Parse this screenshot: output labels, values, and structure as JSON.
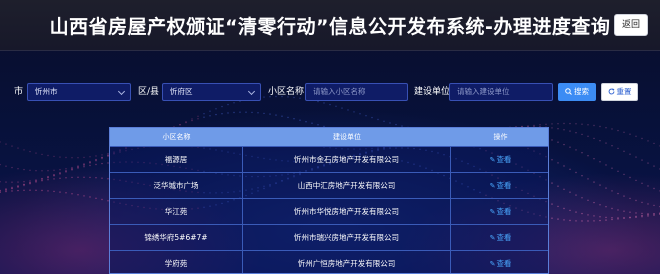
{
  "header": {
    "title": "山西省房屋产权颁证“清零行动”信息公开发布系统-办理进度查询",
    "back_label": "返回"
  },
  "filters": {
    "city_label": "市",
    "city_value": "忻州市",
    "district_label": "区/县",
    "district_value": "忻府区",
    "community_label": "小区名称",
    "community_placeholder": "请输入小区名称",
    "builder_label": "建设单位",
    "builder_placeholder": "请输入建设单位",
    "search_label": "搜索",
    "reset_label": "重置"
  },
  "table": {
    "headers": [
      "小区名称",
      "建设单位",
      "操作"
    ],
    "rows": [
      {
        "name": "福源居",
        "builder": "忻州市金石房地产开发有限公司",
        "action": "查看"
      },
      {
        "name": "泛华城市广场",
        "builder": "山西中汇房地产开发有限公司",
        "action": "查看"
      },
      {
        "name": "华江苑",
        "builder": "忻州市华悦房地产开发有限公司",
        "action": "查看"
      },
      {
        "name": "锦绣华府5#6#7#",
        "builder": "忻州市瑞兴房地产开发有限公司",
        "action": "查看"
      },
      {
        "name": "学府苑",
        "builder": "忻州广恒房地产开发有限公司",
        "action": "查看"
      }
    ]
  },
  "colors": {
    "background": "#050a2e",
    "table_header": "#6f9be8",
    "accent": "#3c8cf4",
    "link": "#4aa8ff"
  }
}
